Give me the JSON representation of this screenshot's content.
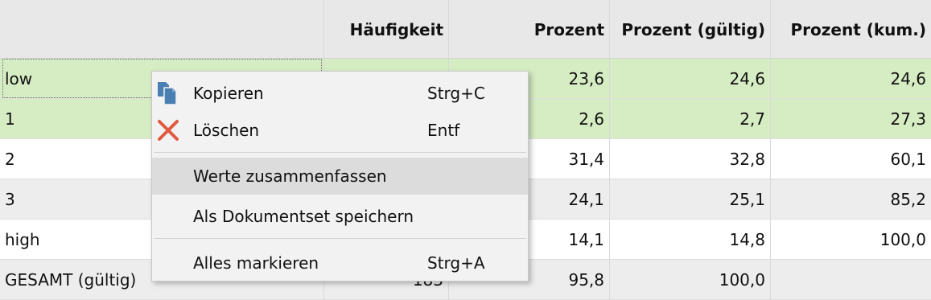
{
  "table": {
    "headers": [
      "",
      "Häufigkeit",
      "Prozent",
      "Prozent (gültig)",
      "Prozent (kum.)"
    ],
    "rows": [
      {
        "label": "low",
        "haeufigkeit": "",
        "prozent": "23,6",
        "gueltig": "24,6",
        "kum": "24,6"
      },
      {
        "label": "1",
        "haeufigkeit": "",
        "prozent": "2,6",
        "gueltig": "2,7",
        "kum": "27,3"
      },
      {
        "label": "2",
        "haeufigkeit": "",
        "prozent": "31,4",
        "gueltig": "32,8",
        "kum": "60,1"
      },
      {
        "label": "3",
        "haeufigkeit": "",
        "prozent": "24,1",
        "gueltig": "25,1",
        "kum": "85,2"
      },
      {
        "label": "high",
        "haeufigkeit": "",
        "prozent": "14,1",
        "gueltig": "14,8",
        "kum": "100,0"
      },
      {
        "label": "GESAMT (gültig)",
        "haeufigkeit": "183",
        "prozent": "95,8",
        "gueltig": "100,0",
        "kum": ""
      }
    ],
    "selected_row_color": "#d6ecc3"
  },
  "context_menu": {
    "items": [
      {
        "label": "Kopieren",
        "shortcut": "Strg+C",
        "icon": "copy-icon"
      },
      {
        "label": "Löschen",
        "shortcut": "Entf",
        "icon": "delete-x-icon"
      },
      {
        "label": "Werte zusammenfassen",
        "shortcut": ""
      },
      {
        "label": "Als Dokumentset speichern",
        "shortcut": ""
      },
      {
        "label": "Alles markieren",
        "shortcut": "Strg+A"
      }
    ],
    "highlighted_item": "Werte zusammenfassen"
  }
}
